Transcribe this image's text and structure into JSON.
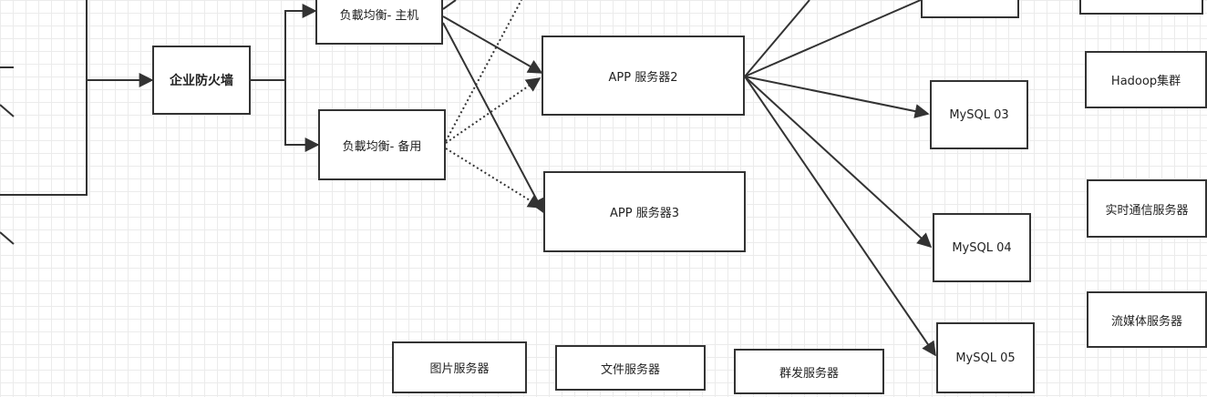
{
  "nodes": {
    "firewall": "企业防火墙",
    "lb_main": "负載均衡- 主机",
    "lb_backup": "负載均衡- 备用",
    "app2": "APP 服务器2",
    "app3": "APP 服务器3",
    "mysql03": "MySQL 03",
    "mysql04": "MySQL 04",
    "mysql05": "MySQL 05",
    "hadoop": "Hadoop集群",
    "realtime": "实时通信服务器",
    "streaming": "流媒体服务器",
    "image_server": "图片服务器",
    "file_server": "文件服务器",
    "mass_server": "群发服务器"
  },
  "colors": {
    "line": "#333333",
    "grid": "#ebebeb",
    "background": "#ffffff"
  }
}
